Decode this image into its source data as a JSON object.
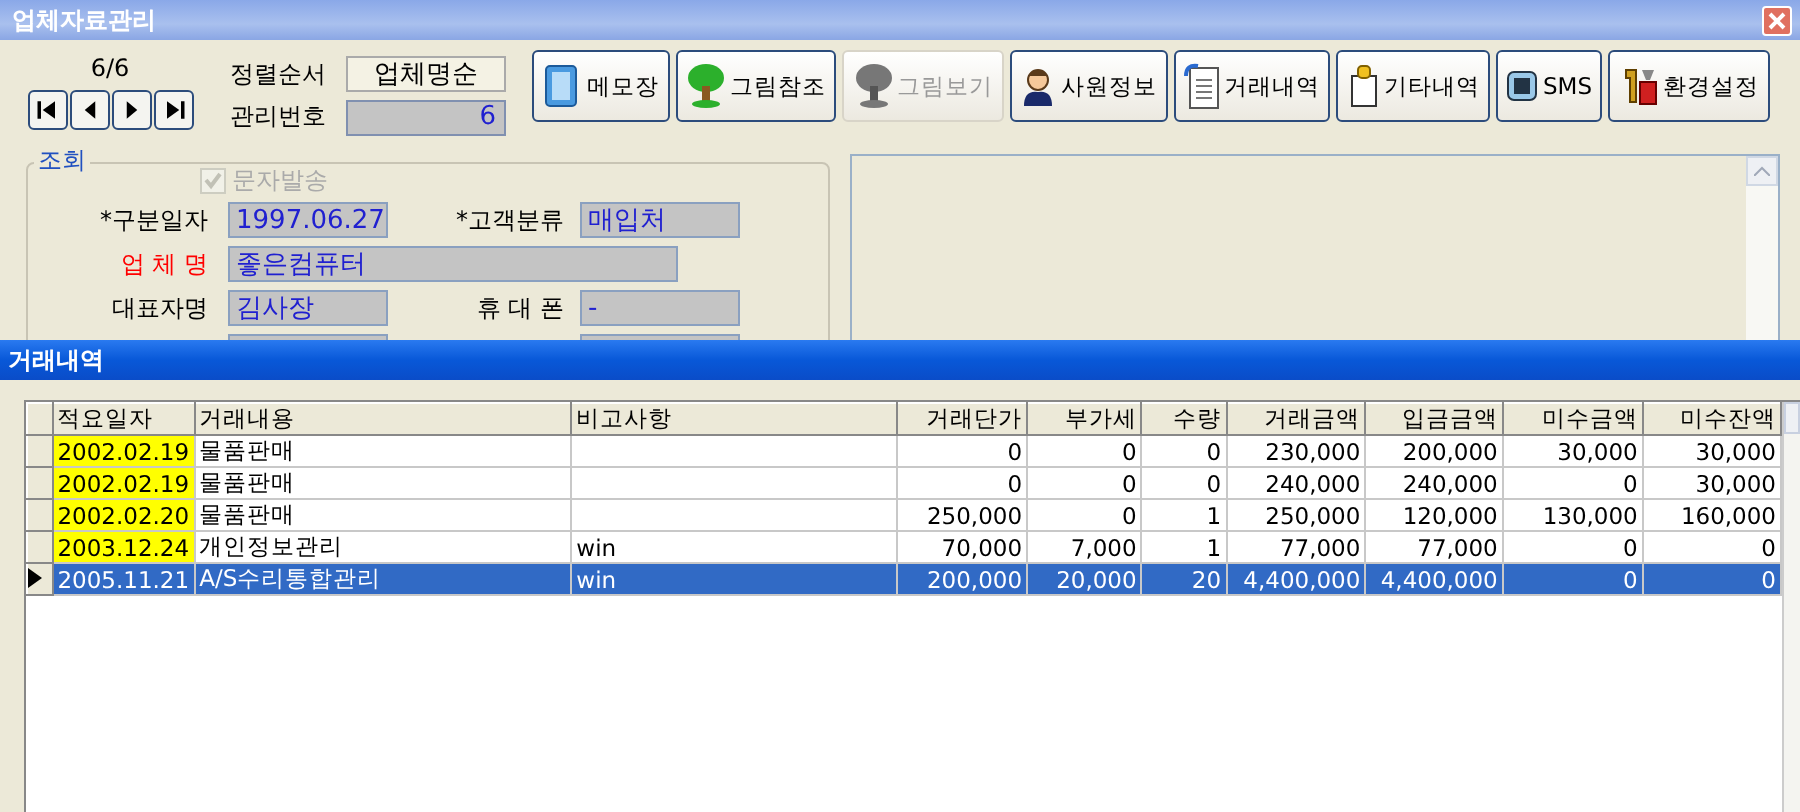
{
  "main_window": {
    "title": "업체자료관리",
    "record_counter": "6/6",
    "sort_order": {
      "label": "정렬순서",
      "value": "업체명순"
    },
    "management_no": {
      "label": "관리번호",
      "value": "6"
    },
    "toolbar": [
      {
        "label": "메모장",
        "kind": "notepad",
        "disabled": false
      },
      {
        "label": "그림참조",
        "kind": "tree",
        "disabled": false
      },
      {
        "label": "그림보기",
        "kind": "tree",
        "disabled": true
      },
      {
        "label": "사원정보",
        "kind": "person",
        "disabled": false
      },
      {
        "label": "거래내역",
        "kind": "document",
        "disabled": false
      },
      {
        "label": "기타내역",
        "kind": "clipboard",
        "disabled": false
      },
      {
        "label": "SMS",
        "kind": "phone",
        "disabled": false
      },
      {
        "label": "환경설정",
        "kind": "tools",
        "disabled": false
      }
    ],
    "lookup": {
      "title": "조회",
      "sms_checkbox": {
        "label": "문자발송",
        "checked": true,
        "disabled": true
      },
      "rows": [
        {
          "fields": [
            {
              "label": "*구분일자",
              "value": "1997.06.27",
              "color": "#000000"
            },
            {
              "label": "*고객분류",
              "value": "매입처",
              "color": "#000000"
            }
          ]
        },
        {
          "fields": [
            {
              "label": "업 체 명",
              "value": "좋은컴퓨터",
              "color": "#ff0000"
            }
          ]
        },
        {
          "fields": [
            {
              "label": "대표자명",
              "value": "김사장",
              "color": "#000000"
            },
            {
              "label": "휴 대 폰",
              "value": "-",
              "color": "#000000"
            }
          ]
        }
      ]
    }
  },
  "transactions_window": {
    "title": "거래내역",
    "table": {
      "columns": [
        {
          "label": "적요일자"
        },
        {
          "label": "거래내용"
        },
        {
          "label": "비고사항"
        },
        {
          "label": "거래단가"
        },
        {
          "label": "부가세"
        },
        {
          "label": "수량"
        },
        {
          "label": "거래금액"
        },
        {
          "label": "입금금액"
        },
        {
          "label": "미수금액"
        },
        {
          "label": "미수잔액"
        }
      ],
      "rows": [
        {
          "selected": false,
          "highlighted": true,
          "cells": [
            "2002.02.19",
            "물품판매",
            "",
            "0",
            "0",
            "0",
            "230,000",
            "200,000",
            "30,000",
            "30,000"
          ]
        },
        {
          "selected": false,
          "highlighted": true,
          "cells": [
            "2002.02.19",
            "물품판매",
            "",
            "0",
            "0",
            "0",
            "240,000",
            "240,000",
            "0",
            "30,000"
          ]
        },
        {
          "selected": false,
          "highlighted": true,
          "cells": [
            "2002.02.20",
            "물품판매",
            "",
            "250,000",
            "0",
            "1",
            "250,000",
            "120,000",
            "130,000",
            "160,000"
          ]
        },
        {
          "selected": false,
          "highlighted": true,
          "cells": [
            "2003.12.24",
            "개인정보관리",
            "win",
            "70,000",
            "7,000",
            "1",
            "77,000",
            "77,000",
            "0",
            "0"
          ]
        },
        {
          "selected": true,
          "highlighted": false,
          "cells": [
            "2005.11.21",
            "A/S수리통합관리",
            "win",
            "200,000",
            "20,000",
            "20",
            "4,400,000",
            "4,400,000",
            "0",
            "0"
          ]
        }
      ]
    }
  }
}
